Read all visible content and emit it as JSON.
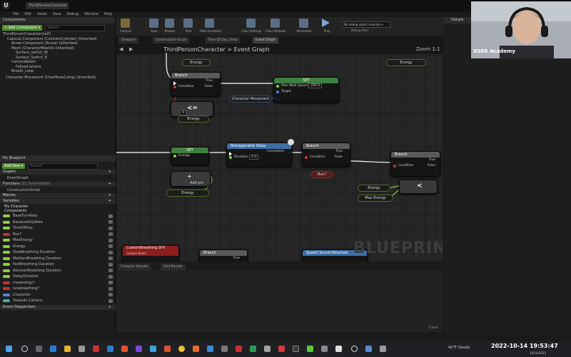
{
  "window": {
    "file_tab": "ThirdPersonCharacter"
  },
  "menu": [
    "File",
    "Edit",
    "Asset",
    "View",
    "Debug",
    "Window",
    "Help"
  ],
  "components_panel": {
    "header": "Components",
    "add_label": "+ Add Component ▾",
    "search_placeholder": "Search",
    "root": "ThirdPersonCharacter(self)",
    "items": [
      "Capsule Component (CollisionCylinder) (Inherited)",
      "Arrow Component (Arrow) (Inherited)",
      "Mesh (CharacterMesh0) (Inherited)",
      "Surface_switch_W",
      "Surface_Switch_R",
      "CameraBoom",
      "FollowCamera",
      "Breath_Loop",
      "Character Movement (CharMoveComp) (Inherited)"
    ]
  },
  "my_blueprint": {
    "header": "My Blueprint",
    "add_label": "Add New ▾",
    "search_placeholder": "Search",
    "graphs_label": "Graphs",
    "graph_item": "EventGraph",
    "functions_label": "Functions",
    "functions_count": "(31 Overridable)",
    "function_item": "ConstructionScript",
    "macros_label": "Macros",
    "variables_label": "Variables",
    "my_character_label": "My Character",
    "components_label": "Components",
    "variables": [
      {
        "name": "BaseTurnRate",
        "color": "#8fce3b"
      },
      {
        "name": "BaseLookUpRate",
        "color": "#8fce3b"
      },
      {
        "name": "TimeOfDay",
        "color": "#8fce3b"
      },
      {
        "name": "Run?",
        "color": "#c8312c"
      },
      {
        "name": "MaxEnergy",
        "color": "#8fce3b"
      },
      {
        "name": "Energy",
        "color": "#8fce3b"
      },
      {
        "name": "SlowBreathing Duration",
        "color": "#8fce3b"
      },
      {
        "name": "MediumBreathing Duration",
        "color": "#8fce3b"
      },
      {
        "name": "FastBreathing Duration",
        "color": "#8fce3b"
      },
      {
        "name": "RecoverBreathing Duration",
        "color": "#8fce3b"
      },
      {
        "name": "DelayDuration",
        "color": "#8fce3b"
      },
      {
        "name": "maxenergy?",
        "color": "#c8312c"
      },
      {
        "name": "isnebreathing?",
        "color": "#c8312c"
      },
      {
        "name": "Character",
        "color": "#4b8ad6"
      },
      {
        "name": "Towards Camera",
        "color": "#44b3a0"
      }
    ],
    "event_dispatchers_label": "Event Dispatchers"
  },
  "toolbar": {
    "buttons": [
      "Compile",
      "Save",
      "Browse",
      "Find",
      "Hide Unrelated",
      "Class Settings",
      "Class Defaults",
      "Simulation",
      "Play"
    ],
    "debug_select": "No debug object selected ▾",
    "debug_label": "Debug Filter"
  },
  "editor_tabs": [
    "Viewport",
    "Construction Script",
    "Time Of Day_Temp",
    "Event Graph"
  ],
  "graph": {
    "breadcrumb": "ThirdPersonCharacter  >  Event Graph",
    "zoom": "Zoom 1:1",
    "watermark": "BLUEPRINT",
    "nodes": {
      "energy_top": "Energy",
      "energy_top_right": "Energy",
      "branch1": "Branch",
      "condition": "Condition",
      "true_pin": "True",
      "false_pin": "False",
      "set_node": "SET",
      "max_walk_speed": "Max Walk Speed",
      "max_walk_value": "200.0",
      "target": "Target",
      "character_movement": "Character Movement",
      "lte": "<=",
      "lte_value": "0",
      "energy_mid": "Energy",
      "set2": "SET",
      "energy_set": "Energy",
      "retriggerable_delay": "Retriggerable Delay",
      "completed": "Completed",
      "duration": "Duration",
      "duration_value": "2.0",
      "branch2": "Branch",
      "run_q": "Run?",
      "branch3": "Branch",
      "lt": "<",
      "energy_lt": "Energy",
      "max_energy": "Max Energy",
      "add_pin": "Add pin",
      "energy_lower": "Energy",
      "custom_event": "CustomBreathing SFX",
      "custom_event_sub": "Custom Event",
      "branch4": "Branch",
      "spawn_sound": "Spawn Sound Attached"
    }
  },
  "bottom_tabs": [
    "Compiler Results",
    "Find Results"
  ],
  "clear_label": "Clear",
  "details_header": "Details",
  "webcam_caption": "XSSR Academy",
  "taskbar": {
    "weather": "42°F  Cloudy",
    "clock": "2022-10-14 19:53:47",
    "date": "10/14/2022"
  },
  "colors": {
    "branch_header": "#5a5a5a",
    "set_header": "#3f7f3f",
    "delay_header": "#3c6fa8",
    "event_header": "#8d1e1e",
    "exec": "#ffffff",
    "float_pin": "#8fce3b",
    "object_pin": "#4b8ad6",
    "bool_pin": "#c8312c"
  }
}
